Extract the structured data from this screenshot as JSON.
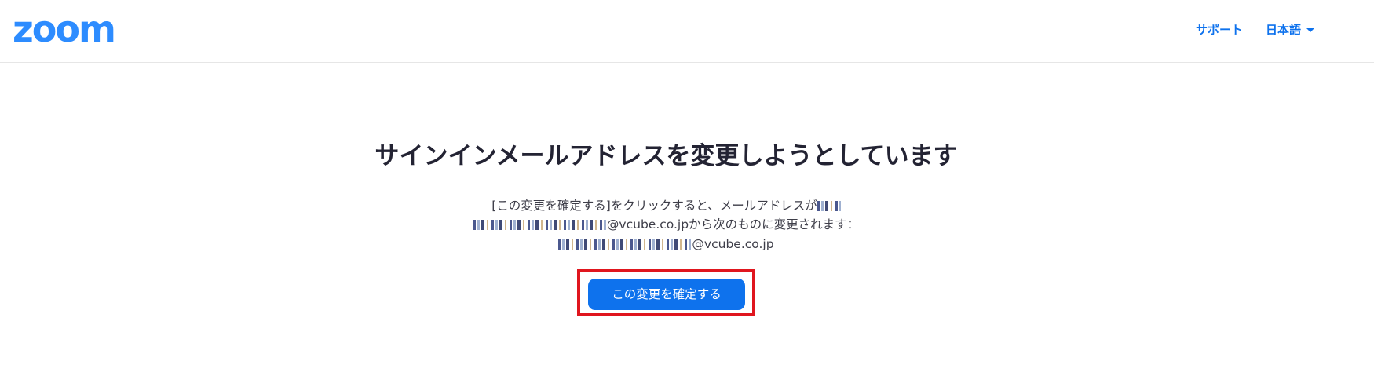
{
  "header": {
    "logo_text": "zoom",
    "support_label": "サポート",
    "language_label": "日本語"
  },
  "main": {
    "title": "サインインメールアドレスを変更しようとしています",
    "line1_text": "[この変更を確定する]をクリックすると、メールアドレスが",
    "line2_old_email_domain": "@vcube.co.jp",
    "line2_suffix": "から次のものに変更されます：",
    "line3_new_email_domain": "@vcube.co.jp",
    "confirm_button_label": "この変更を確定する"
  },
  "colors": {
    "brand_blue": "#2d8cff",
    "link_blue": "#0e72ed",
    "button_blue": "#0e72ed",
    "highlight_red": "#e0161e",
    "title_text": "#232333"
  },
  "icons": {
    "language_dropdown": "caret-down-icon"
  }
}
